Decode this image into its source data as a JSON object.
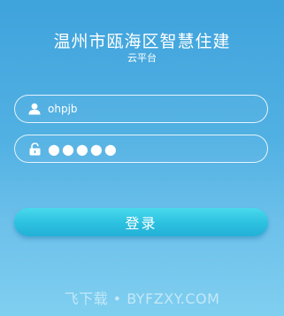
{
  "header": {
    "title": "温州市瓯海区智慧住建",
    "subtitle": "云平台"
  },
  "form": {
    "username_value": "ohpjb",
    "password_value": "●●●●●",
    "user_icon": "user-icon",
    "lock_icon": "lock-icon",
    "login_label": "登录"
  },
  "watermark": {
    "text": "飞下载 • BYFZXY.COM"
  },
  "colors": {
    "background_top": "#3fa3dc",
    "background_bottom": "#7fcff0",
    "button": "#2cc0e0",
    "text": "#ffffff"
  }
}
